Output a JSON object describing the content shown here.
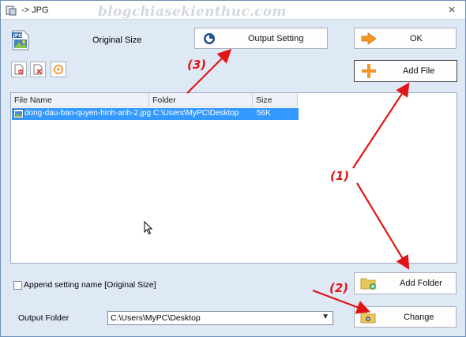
{
  "window": {
    "title": "-> JPG",
    "watermark": "blogchiasekienthuc.com",
    "close_glyph": "×"
  },
  "format": {
    "icon": "jpg-file-icon",
    "icon_text": "JPG",
    "size_label": "Original Size"
  },
  "buttons": {
    "output_setting": "Output Setting",
    "ok": "OK",
    "add_file": "Add File",
    "add_folder": "Add Folder",
    "change": "Change"
  },
  "toolbar": {
    "items": [
      "remove-file-icon",
      "clear-list-icon",
      "play-icon"
    ]
  },
  "file_list": {
    "columns": [
      "File Name",
      "Folder",
      "Size"
    ],
    "rows": [
      {
        "file_name": "dong-dau-ban-quyen-hinh-anh-2.jpg",
        "folder": "C:\\Users\\MyPC\\Desktop",
        "size": "56K",
        "selected": true
      }
    ]
  },
  "append_setting": {
    "label": "Append setting name [Original Size]",
    "checked": false
  },
  "output_folder": {
    "label": "Output Folder",
    "value": "C:\\Users\\MyPC\\Desktop"
  },
  "annotations": {
    "label_1": "(1)",
    "label_2": "(2)",
    "label_3": "(3)",
    "color": "#e01515"
  },
  "colors": {
    "window_bg": "#dfe8f5",
    "selection": "#3399ff"
  }
}
